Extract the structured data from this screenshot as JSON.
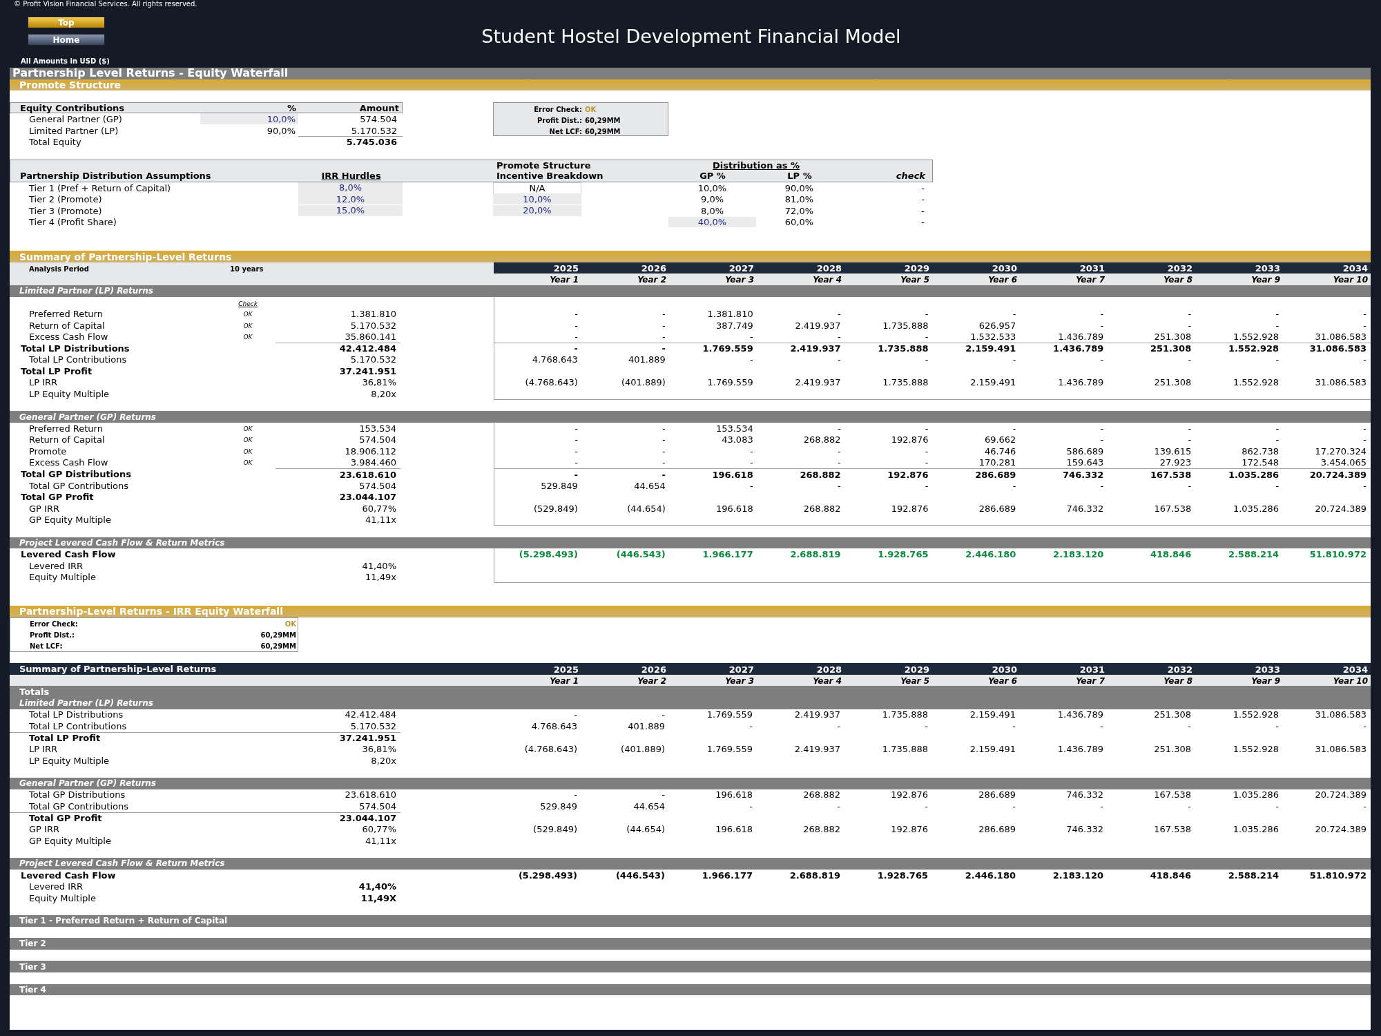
{
  "header": {
    "copyright": "© Profit Vision Financial Services. All rights reserved.",
    "buttons": [
      {
        "label": "Top",
        "kind": "gold"
      },
      {
        "label": "Home",
        "kind": "slate"
      }
    ],
    "title": "Student Hostel Development Financial Model",
    "currency_note": "All Amounts in  USD ($)"
  },
  "page_title": "Partnership Level Returns - Equity Waterfall",
  "promote": {
    "title": "Promote Structure",
    "equity": {
      "columns": [
        "Equity Contributions",
        "%",
        "Amount"
      ],
      "rows": [
        {
          "label": "General Partner (GP)",
          "pct": "10,0%",
          "amount": "574.504",
          "input": true
        },
        {
          "label": "Limited Partner (LP)",
          "pct": "90,0%",
          "amount": "5.170.532",
          "input": false
        }
      ],
      "total": {
        "label": "Total Equity",
        "amount": "5.745.036"
      }
    },
    "checks": [
      {
        "label": "Error Check:",
        "value": "OK",
        "kind": "status"
      },
      {
        "label": "Profit Dist.:",
        "value": "60,29MM",
        "kind": "plain"
      },
      {
        "label": "Net LCF:",
        "value": "60,29MM",
        "kind": "plain"
      }
    ],
    "distribution": {
      "title": "Partnership Distribution Assumptions",
      "irr_header": "IRR Hurdles",
      "promote_header": "Promote Structure",
      "incentive_header": "Incentive Breakdown",
      "split_header": "Distribution as %",
      "gp_header": "GP %",
      "lp_header": "LP %",
      "check_header": "check",
      "tiers": [
        {
          "label": "Tier 1 (Pref + Return of Capital)",
          "irr": "8,0%",
          "incentive": "N/A",
          "incentive_input": false,
          "gp": "10,0%",
          "gp_input": false,
          "lp": "90,0%",
          "check": "-"
        },
        {
          "label": "Tier 2 (Promote)",
          "irr": "12,0%",
          "incentive": "10,0%",
          "incentive_input": true,
          "gp": "9,0%",
          "gp_input": false,
          "lp": "81,0%",
          "check": "-"
        },
        {
          "label": "Tier 3 (Promote)",
          "irr": "15,0%",
          "incentive": "20,0%",
          "incentive_input": true,
          "gp": "8,0%",
          "gp_input": false,
          "lp": "72,0%",
          "check": "-"
        },
        {
          "label": "Tier 4 (Profit Share)",
          "gp": "40,0%",
          "gp_input": true,
          "lp": "60,0%",
          "check": "-"
        }
      ]
    }
  },
  "summary": {
    "title": "Summary of Partnership-Level Returns",
    "period_label": "Analysis Period",
    "period": "10 years",
    "years": [
      "2025",
      "2026",
      "2027",
      "2028",
      "2029",
      "2030",
      "2031",
      "2032",
      "2033",
      "2034"
    ],
    "year_labels": [
      "Year 1",
      "Year 2",
      "Year 3",
      "Year 4",
      "Year 5",
      "Year 6",
      "Year 7",
      "Year 8",
      "Year 9",
      "Year 10"
    ],
    "sections": [
      {
        "title": "Limited Partner (LP) Returns",
        "check_header": "Check",
        "rows": [
          {
            "label": "Preferred Return",
            "kind": "item",
            "check": "OK",
            "total": "1.381.810",
            "values": [
              "-",
              "-",
              "1.381.810",
              "-",
              "-",
              "-",
              "-",
              "-",
              "-",
              "-"
            ]
          },
          {
            "label": "Return of Capital",
            "kind": "item",
            "check": "OK",
            "total": "5.170.532",
            "values": [
              "-",
              "-",
              "387.749",
              "2.419.937",
              "1.735.888",
              "626.957",
              "-",
              "-",
              "-",
              "-"
            ]
          },
          {
            "label": "Excess Cash Flow",
            "kind": "item",
            "check": "OK",
            "total": "35.860.141",
            "values": [
              "-",
              "-",
              "-",
              "-",
              "-",
              "1.532.533",
              "1.436.789",
              "251.308",
              "1.552.928",
              "31.086.583"
            ]
          },
          {
            "label": "Total LP Distributions",
            "kind": "total_ruled",
            "total": "42.412.484",
            "values": [
              "-",
              "-",
              "1.769.559",
              "2.419.937",
              "1.735.888",
              "2.159.491",
              "1.436.789",
              "251.308",
              "1.552.928",
              "31.086.583"
            ]
          },
          {
            "label": "Total LP Contributions",
            "kind": "item",
            "total": "5.170.532",
            "values": [
              "4.768.643",
              "401.889",
              "-",
              "-",
              "-",
              "-",
              "-",
              "-",
              "-",
              "-"
            ]
          },
          {
            "label": "Total LP Profit",
            "kind": "total",
            "total": "37.241.951"
          },
          {
            "label": "LP IRR",
            "kind": "item",
            "total": "36,81%",
            "values": [
              "(4.768.643)",
              "(401.889)",
              "1.769.559",
              "2.419.937",
              "1.735.888",
              "2.159.491",
              "1.436.789",
              "251.308",
              "1.552.928",
              "31.086.583"
            ]
          },
          {
            "label": "LP Equity Multiple",
            "kind": "item",
            "total": "8,20x"
          }
        ]
      },
      {
        "title": "General Partner (GP) Returns",
        "rows": [
          {
            "label": "Preferred Return",
            "kind": "item",
            "check": "OK",
            "total": "153.534",
            "values": [
              "-",
              "-",
              "153.534",
              "-",
              "-",
              "-",
              "-",
              "-",
              "-",
              "-"
            ]
          },
          {
            "label": "Return of Capital",
            "kind": "item",
            "check": "OK",
            "total": "574.504",
            "values": [
              "-",
              "-",
              "43.083",
              "268.882",
              "192.876",
              "69.662",
              "-",
              "-",
              "-",
              "-"
            ]
          },
          {
            "label": "Promote",
            "kind": "item",
            "check": "OK",
            "total": "18.906.112",
            "values": [
              "-",
              "-",
              "-",
              "-",
              "-",
              "46.746",
              "586.689",
              "139.615",
              "862.738",
              "17.270.324"
            ]
          },
          {
            "label": "Excess Cash Flow",
            "kind": "item",
            "check": "OK",
            "total": "3.984.460",
            "values": [
              "-",
              "-",
              "-",
              "-",
              "-",
              "170.281",
              "159.643",
              "27.923",
              "172.548",
              "3.454.065"
            ]
          },
          {
            "label": "Total GP Distributions",
            "kind": "total_ruled",
            "total": "23.618.610",
            "values": [
              "-",
              "-",
              "196.618",
              "268.882",
              "192.876",
              "286.689",
              "746.332",
              "167.538",
              "1.035.286",
              "20.724.389"
            ]
          },
          {
            "label": "Total GP Contributions",
            "kind": "item",
            "total": "574.504",
            "values": [
              "529.849",
              "44.654",
              "-",
              "-",
              "-",
              "-",
              "-",
              "-",
              "-",
              "-"
            ]
          },
          {
            "label": "Total GP Profit",
            "kind": "total",
            "total": "23.044.107"
          },
          {
            "label": "GP IRR",
            "kind": "item",
            "total": "60,77%",
            "values": [
              "(529.849)",
              "(44.654)",
              "196.618",
              "268.882",
              "192.876",
              "286.689",
              "746.332",
              "167.538",
              "1.035.286",
              "20.724.389"
            ]
          },
          {
            "label": "GP Equity Multiple",
            "kind": "item",
            "total": "41,11x"
          }
        ]
      },
      {
        "title": "Project Levered Cash Flow & Return Metrics",
        "rows": [
          {
            "label": "Levered Cash Flow",
            "kind": "total",
            "color": "#0b8a3e",
            "values": [
              "(5.298.493)",
              "(446.543)",
              "1.966.177",
              "2.688.819",
              "1.928.765",
              "2.446.180",
              "2.183.120",
              "418.846",
              "2.588.214",
              "51.810.972"
            ]
          },
          {
            "label": "Levered IRR",
            "kind": "item",
            "total": "41,40%"
          },
          {
            "label": "Equity Multiple",
            "kind": "item",
            "total": "11,49x"
          }
        ]
      }
    ]
  },
  "waterfall": {
    "title": "Partnership-Level Returns - IRR Equity Waterfall",
    "checks": [
      {
        "label": "Error Check:",
        "value": "OK",
        "kind": "status"
      },
      {
        "label": "Profit Dist.:",
        "value": "60,29MM",
        "kind": "plain"
      },
      {
        "label": "Net LCF:",
        "value": "60,29MM",
        "kind": "plain"
      }
    ],
    "summary": {
      "title": "Summary of Partnership-Level Returns",
      "totals_label": "Totals",
      "years": [
        "2025",
        "2026",
        "2027",
        "2028",
        "2029",
        "2030",
        "2031",
        "2032",
        "2033",
        "2034"
      ],
      "year_labels": [
        "Year 1",
        "Year 2",
        "Year 3",
        "Year 4",
        "Year 5",
        "Year 6",
        "Year 7",
        "Year 8",
        "Year 9",
        "Year 10"
      ],
      "sections": [
        {
          "title": "Limited Partner (LP) Returns",
          "rows": [
            {
              "label": "Total LP Distributions",
              "kind": "item",
              "total": "42.412.484",
              "values": [
                "-",
                "-",
                "1.769.559",
                "2.419.937",
                "1.735.888",
                "2.159.491",
                "1.436.789",
                "251.308",
                "1.552.928",
                "31.086.583"
              ]
            },
            {
              "label": "Total LP Contributions",
              "kind": "item",
              "total": "5.170.532",
              "values": [
                "4.768.643",
                "401.889",
                "-",
                "-",
                "-",
                "-",
                "-",
                "-",
                "-",
                "-"
              ]
            },
            {
              "label": "Total LP Profit",
              "kind": "subtotal_ruled",
              "total": "37.241.951"
            },
            {
              "label": "LP IRR",
              "kind": "item",
              "total": "36,81%",
              "values": [
                "(4.768.643)",
                "(401.889)",
                "1.769.559",
                "2.419.937",
                "1.735.888",
                "2.159.491",
                "1.436.789",
                "251.308",
                "1.552.928",
                "31.086.583"
              ]
            },
            {
              "label": "LP Equity Multiple",
              "kind": "item",
              "total": "8,20x"
            }
          ]
        },
        {
          "title": "General Partner (GP) Returns",
          "rows": [
            {
              "label": "Total GP Distributions",
              "kind": "item",
              "total": "23.618.610",
              "values": [
                "-",
                "-",
                "196.618",
                "268.882",
                "192.876",
                "286.689",
                "746.332",
                "167.538",
                "1.035.286",
                "20.724.389"
              ]
            },
            {
              "label": "Total GP Contributions",
              "kind": "item",
              "total": "574.504",
              "values": [
                "529.849",
                "44.654",
                "-",
                "-",
                "-",
                "-",
                "-",
                "-",
                "-",
                "-"
              ]
            },
            {
              "label": "Total GP Profit",
              "kind": "subtotal_ruled",
              "total": "23.044.107"
            },
            {
              "label": "GP IRR",
              "kind": "item",
              "total": "60,77%",
              "values": [
                "(529.849)",
                "(44.654)",
                "196.618",
                "268.882",
                "192.876",
                "286.689",
                "746.332",
                "167.538",
                "1.035.286",
                "20.724.389"
              ]
            },
            {
              "label": "GP Equity Multiple",
              "kind": "item",
              "total": "41,11x"
            }
          ]
        },
        {
          "title": "Project Levered Cash Flow & Return Metrics",
          "rows": [
            {
              "label": "Levered Cash Flow",
              "kind": "total",
              "values": [
                "(5.298.493)",
                "(446.543)",
                "1.966.177",
                "2.688.819",
                "1.928.765",
                "2.446.180",
                "2.183.120",
                "418.846",
                "2.588.214",
                "51.810.972"
              ]
            },
            {
              "label": "Levered IRR",
              "kind": "metric_strong",
              "total": "41,40%"
            },
            {
              "label": "Equity Multiple",
              "kind": "metric_strong",
              "total": "11,49X"
            }
          ]
        }
      ]
    },
    "tiers": [
      "Tier 1 - Preferred Return + Return of Capital",
      "Tier 2",
      "Tier 3",
      "Tier 4"
    ]
  }
}
